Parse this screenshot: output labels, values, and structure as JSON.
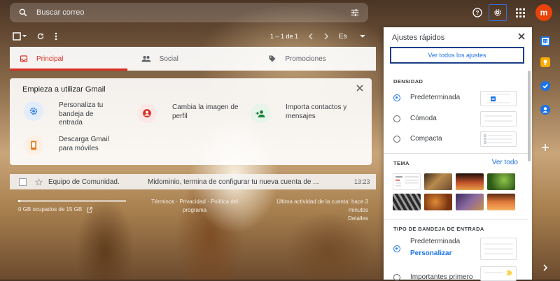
{
  "search": {
    "placeholder": "Buscar correo"
  },
  "account": {
    "avatar_letter": "m",
    "avatar_color": "#e8430a"
  },
  "pager": {
    "range": "1 – 1 de 1",
    "lang": "Es"
  },
  "tabs": [
    {
      "label": "Principal",
      "active": true,
      "icon": "inbox-icon"
    },
    {
      "label": "Social",
      "active": false,
      "icon": "people-icon"
    },
    {
      "label": "Promociones",
      "active": false,
      "icon": "tag-icon"
    }
  ],
  "getting_started": {
    "title": "Empieza a utilizar Gmail",
    "tasks": [
      {
        "text": "Personaliza tu bandeja de entrada",
        "icon": "gear-icon",
        "color": "#1a73e8"
      },
      {
        "text": "Cambia la imagen de perfil",
        "icon": "account-icon",
        "color": "#d93025"
      },
      {
        "text": "Importa contactos y mensajes",
        "icon": "person-add-icon",
        "color": "#188038"
      },
      {
        "text": "Descarga Gmail para móviles",
        "icon": "phone-icon",
        "color": "#e8710a"
      }
    ]
  },
  "email": {
    "from": "Equipo de Comunidad.",
    "subject": "Midominio, termina de configurar tu nueva cuenta de ...",
    "time": "13:23"
  },
  "footer": {
    "storage": "0 GB ocupados de 15 GB",
    "storage_fraction": 0.02,
    "terms": "Términos · Privacidad · Política del programa",
    "activity": "Última actividad de la cuenta: hace 3 minutos",
    "details": "Detalles"
  },
  "quick_settings": {
    "title": "Ajustes rápidos",
    "see_all_button": "Ver todos los ajustes",
    "density": {
      "heading": "DENSIDAD",
      "options": [
        {
          "label": "Predeterminada",
          "selected": true
        },
        {
          "label": "Cómoda",
          "selected": false
        },
        {
          "label": "Compacta",
          "selected": false
        }
      ]
    },
    "theme": {
      "heading": "TEMA",
      "see_all": "Ver todo"
    },
    "inbox_type": {
      "heading": "TIPO DE BANDEJA DE ENTRADA",
      "options": [
        {
          "label": "Predeterminada",
          "selected": true,
          "link": "Personalizar"
        },
        {
          "label": "Importantes primero",
          "selected": false
        }
      ]
    }
  },
  "colors": {
    "accent": "#1a73e8",
    "active_tab": "#d93025"
  }
}
